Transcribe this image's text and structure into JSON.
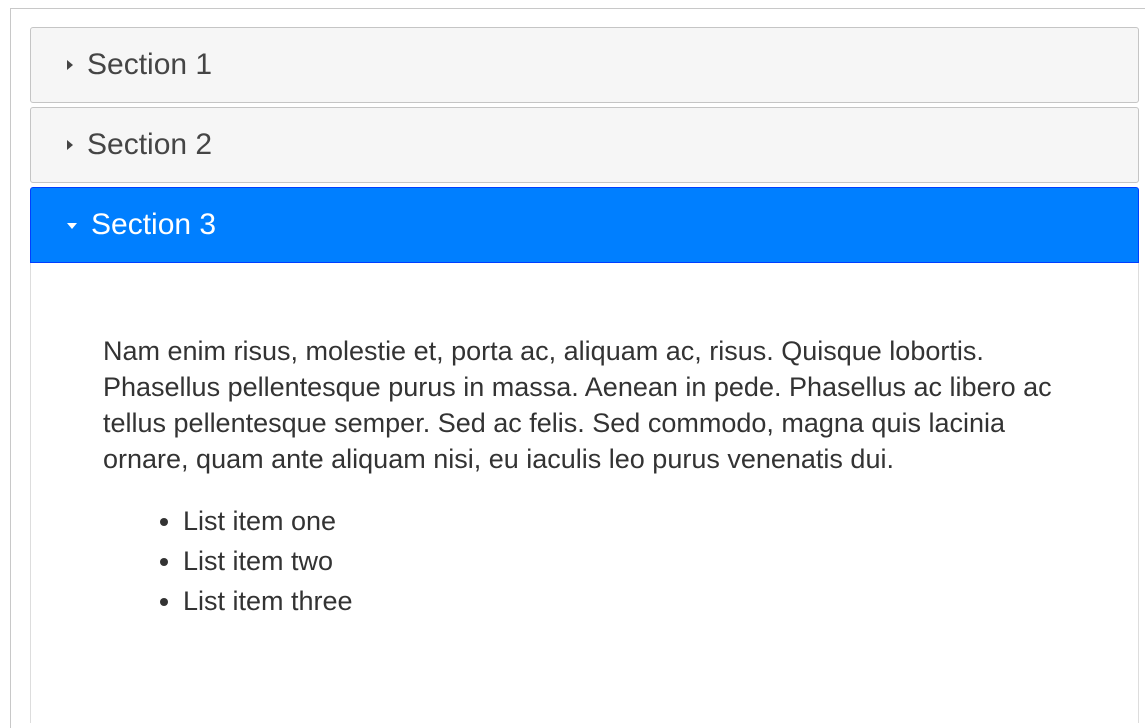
{
  "accordion": {
    "sections": [
      {
        "label": "Section 1",
        "expanded": false
      },
      {
        "label": "Section 2",
        "expanded": false
      },
      {
        "label": "Section 3",
        "expanded": true
      }
    ],
    "active_panel": {
      "paragraph": "Nam enim risus, molestie et, porta ac, aliquam ac, risus. Quisque lobortis. Phasellus pellentesque purus in massa. Aenean in pede. Phasellus ac libero ac tellus pellentesque semper. Sed ac felis. Sed commodo, magna quis lacinia ornare, quam ante aliquam nisi, eu iaculis leo purus venenatis dui.",
      "list_items": [
        "List item one",
        "List item two",
        "List item three"
      ]
    }
  },
  "colors": {
    "active_header": "#007fff",
    "inactive_header": "#f6f6f6",
    "text": "#333333"
  },
  "icons": {
    "collapsed": "triangle-right-icon",
    "expanded": "triangle-down-icon"
  }
}
